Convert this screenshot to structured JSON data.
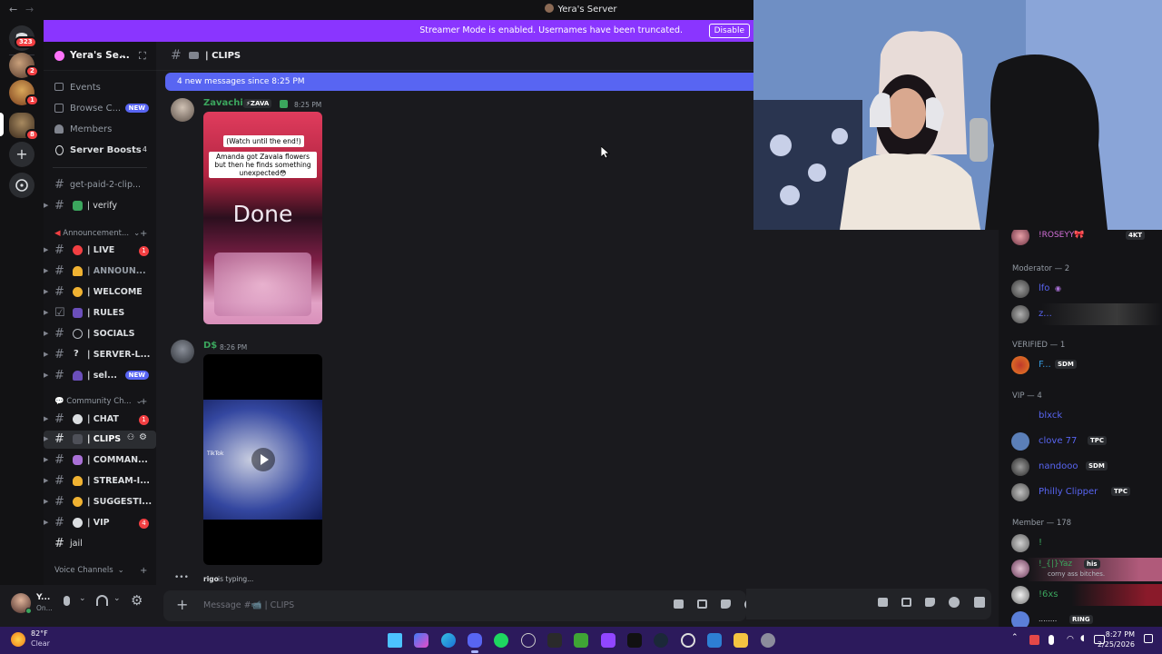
{
  "titlebar": {
    "title": "Yera's Server",
    "back": "←",
    "forward": "→"
  },
  "server_badges": {
    "dm": "323",
    "s1": "2",
    "s2": "1",
    "s3": "8"
  },
  "banner": {
    "text": "Streamer Mode is enabled. Usernames have been truncated.",
    "button": "Disable"
  },
  "server": {
    "name": "Yera's Se..."
  },
  "sidebar_top": [
    {
      "label": "Events"
    },
    {
      "label": "Browse C...",
      "badge": "NEW"
    },
    {
      "label": "Members"
    },
    {
      "label": "Server Boosts",
      "count": "4"
    }
  ],
  "channels": [
    {
      "name": "get-paid-2-clip..."
    },
    {
      "name": "| verify"
    }
  ],
  "categories": {
    "announcements": "Announcement...",
    "community": "Community Ch...",
    "voice": "Voice Channels"
  },
  "announce_channels": [
    {
      "name": "| LIVE",
      "count": "1"
    },
    {
      "name": "| ANNOUN..."
    },
    {
      "name": "| WELCOME"
    },
    {
      "name": "| RULES"
    },
    {
      "name": "| SOCIALS"
    },
    {
      "name": "| SERVER-L..."
    },
    {
      "name": "| sel...",
      "badge": "NEW"
    }
  ],
  "community_channels": [
    {
      "name": "| CHAT",
      "count": "1"
    },
    {
      "name": "| CLIPS"
    },
    {
      "name": "| COMMAN..."
    },
    {
      "name": "| STREAM-I..."
    },
    {
      "name": "| SUGGESTI..."
    },
    {
      "name": "| VIP",
      "count": "4"
    },
    {
      "name": "jail"
    }
  ],
  "user": {
    "name": "Y...",
    "status": "On..."
  },
  "channel_header": {
    "name": "| CLIPS"
  },
  "new_messages": "4 new messages since 8:25 PM",
  "messages": [
    {
      "author": "Zavachip",
      "tag": "ZAVA",
      "time": "8:25 PM",
      "caption1": "(Watch until the end!)",
      "caption2": "Amanda got Zavala flowers but then he finds something unexpected😳",
      "overlay": "Done"
    },
    {
      "author": "D$",
      "time": "8:26 PM",
      "video_label": "TikTok"
    }
  ],
  "typing": {
    "user": "rigo",
    "text": "is typing..."
  },
  "composer": {
    "placeholder": "Message #📹 | CLIPS"
  },
  "members": {
    "top": {
      "name": "!ROSEYY🎀",
      "tag": "4KT"
    },
    "groups": [
      {
        "label": "Moderator — 2"
      },
      {
        "label": "VERIFIED — 1"
      },
      {
        "label": "VIP — 4"
      },
      {
        "label": "Member — 178"
      }
    ],
    "moderators": [
      {
        "name": "lfo"
      },
      {
        "name": "z..."
      }
    ],
    "verified": [
      {
        "name": "F...",
        "tag": "SDM"
      }
    ],
    "vip": [
      {
        "name": "blxck"
      },
      {
        "name": "clove 77",
        "tag": "TPC"
      },
      {
        "name": "nandooo",
        "tag": "SDM"
      },
      {
        "name": "Philly Clipper",
        "tag": "TPC"
      }
    ],
    "member": [
      {
        "name": "!"
      },
      {
        "name": "!_{|}Yaz",
        "tag": "his",
        "status": "corny ass bitches."
      },
      {
        "name": "!6xs"
      },
      {
        "name": "........",
        "tag": "RING"
      }
    ]
  },
  "weather": {
    "temp": "82°F",
    "cond": "Clear"
  },
  "clock": {
    "time": "8:27 PM",
    "date": "2/25/2026"
  },
  "colors": {
    "accent": "#5865f2",
    "streamer": "#8a35ff",
    "green": "#3ba55d",
    "red": "#f23f42",
    "taskbar": "#2c1a5c"
  }
}
